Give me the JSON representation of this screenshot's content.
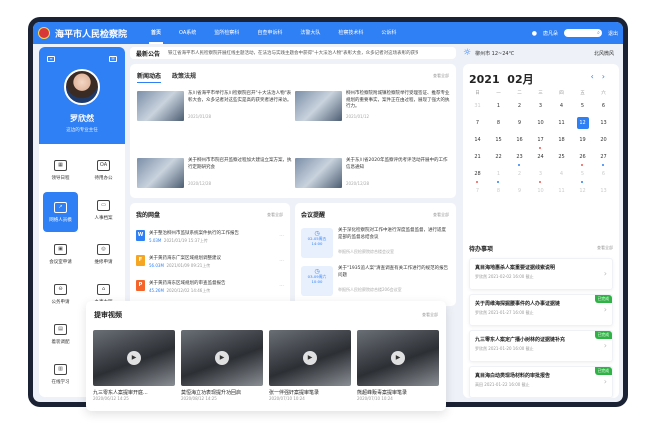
{
  "app": {
    "title": "海平市人民检察院",
    "nav": [
      "首页",
      "OA系统",
      "监所检察科",
      "自查申诉科",
      "法警大队",
      "检察技术科",
      "公诉科"
    ],
    "user_label": "唐凡朵",
    "search_placeholder": "",
    "logout": "退出"
  },
  "profile": {
    "name": "罗欣然",
    "title": "这边的专业主任"
  },
  "menu": [
    {
      "label": "领导日程",
      "icon": "calendar-icon"
    },
    {
      "label": "待用办公",
      "icon": "oa-icon"
    },
    {
      "label": "网络人员模",
      "icon": "chart-icon",
      "active": true
    },
    {
      "label": "人事档案",
      "icon": "folder-icon"
    },
    {
      "label": "会议室申请",
      "icon": "meeting-icon"
    },
    {
      "label": "维修申请",
      "icon": "wrench-icon"
    },
    {
      "label": "公务申请",
      "icon": "car-icon"
    },
    {
      "label": "办事大厅",
      "icon": "hall-icon"
    },
    {
      "label": "着装调配",
      "icon": "clothes-icon"
    },
    {
      "label": "",
      "icon": "blank"
    },
    {
      "label": "在线学习",
      "icon": "study-icon"
    }
  ],
  "announcement": {
    "title": "最新公告",
    "text": "铁江省海平市人民检察院开展红线主题活动，在法治与实践主题会中获得\"十大法治人物\"表彰大会，众多记者对这场表彰的获奖者进行了采访。"
  },
  "weather": {
    "text": "柳州市 12~24℃",
    "location": "北风微风"
  },
  "news": {
    "tabs": [
      "新闻动态",
      "政策法规"
    ],
    "more": "查看全部",
    "items": [
      {
        "title": "东川省海平市举行东川检察院召开\"十大法治人物\"表彰大会，众多记者对这些实是高的获奖者进行采访。",
        "date": "2021/01/28"
      },
      {
        "title": "柳州市检察院附城镇检察院举行受理签证、推荐专业规划的重要事实，案件正在由过程，展现了强大的执行力。",
        "date": "2021/01/12"
      },
      {
        "title": "关于柳州市市院召开监察过程加大建设立案方案，执行定期研究会",
        "date": "2020/12/28"
      },
      {
        "title": "关于东川省2020年监察评优考评活动开展中的工作信息通知",
        "date": "2020/12/28"
      }
    ]
  },
  "disk": {
    "title": "我的网盘",
    "more": "查看全部",
    "files": [
      {
        "name": "关于整治柳州市监狱系统案件执行的工作报告",
        "size": "5.03M",
        "date": "2021/01/19 15:37上传",
        "type": "W",
        "color": "#2f7ff5"
      },
      {
        "name": "关于黄药海东广案区域规划调整建议",
        "size": "56.03M",
        "date": "2021/01/09 09:21上传",
        "type": "F",
        "color": "#f5a623"
      },
      {
        "name": "关于黄药海东区域规划的审查监督报告",
        "size": "45.26M",
        "date": "2020/12/02 14:46上传",
        "type": "P",
        "color": "#f5642a"
      }
    ]
  },
  "meeting": {
    "title": "会议提醒",
    "more": "查看全部",
    "items": [
      {
        "date": "02-05周五",
        "time": "14:00",
        "title": "关于深化检察院对工作中进行深度监督监督，进行适度是部的监督总结会议",
        "loc": "举报所人民检察院综合楼会议室"
      },
      {
        "date": "03-09周六",
        "time": "10:00",
        "title": "关于\"1935追人案\"清查调查有关工作进行的规范的报告问题",
        "loc": "举报所人民检察院综合楼206会议室"
      }
    ]
  },
  "video": {
    "title": "提审视频",
    "more": "查看全部",
    "items": [
      {
        "title": "九三零东人案提审开庭...",
        "date": "2020/06/12  14:25"
      },
      {
        "title": "莫恒海立功表现提升功回启",
        "date": "2020/08/12  14:25"
      },
      {
        "title": "张一伴强奸案提审笔录",
        "date": "2020/07/10  10:24"
      },
      {
        "title": "熊超峰贩毒案提审笔录",
        "date": "2020/07/10  10:24"
      }
    ]
  },
  "calendar": {
    "year": "2021",
    "month": "02月",
    "weekdays": [
      "日",
      "一",
      "二",
      "三",
      "四",
      "五",
      "六"
    ],
    "days": [
      {
        "d": "31",
        "m": true
      },
      {
        "d": "1"
      },
      {
        "d": "2"
      },
      {
        "d": "3"
      },
      {
        "d": "4"
      },
      {
        "d": "5"
      },
      {
        "d": "6"
      },
      {
        "d": "7"
      },
      {
        "d": "8"
      },
      {
        "d": "9"
      },
      {
        "d": "10"
      },
      {
        "d": "11"
      },
      {
        "d": "12",
        "today": true
      },
      {
        "d": "13"
      },
      {
        "d": "14"
      },
      {
        "d": "15"
      },
      {
        "d": "16"
      },
      {
        "d": "17",
        "dot": "#e55"
      },
      {
        "d": "18"
      },
      {
        "d": "19"
      },
      {
        "d": "20"
      },
      {
        "d": "21"
      },
      {
        "d": "22"
      },
      {
        "d": "23",
        "dot": "#2f7ff5"
      },
      {
        "d": "24"
      },
      {
        "d": "25"
      },
      {
        "d": "26",
        "dot": "#e55"
      },
      {
        "d": "27",
        "dot": "#2f7ff5"
      },
      {
        "d": "28",
        "dot": "#e55"
      },
      {
        "d": "1",
        "m": true,
        "dot": "#2f7ff5"
      },
      {
        "d": "2",
        "m": true
      },
      {
        "d": "3",
        "m": true,
        "dot": "#e55"
      },
      {
        "d": "4",
        "m": true
      },
      {
        "d": "5",
        "m": true,
        "dot": "#2f7ff5"
      },
      {
        "d": "6",
        "m": true
      },
      {
        "d": "7",
        "m": true
      },
      {
        "d": "8",
        "m": true
      },
      {
        "d": "9",
        "m": true
      },
      {
        "d": "10",
        "m": true
      },
      {
        "d": "11",
        "m": true
      },
      {
        "d": "12",
        "m": true
      },
      {
        "d": "13",
        "m": true
      }
    ]
  },
  "todo": {
    "title": "待办事项",
    "more": "查看全部",
    "items": [
      {
        "title": "真目海地惠杀人案重要证据线索说明",
        "sub": "罗欣然   2021-02-02 16:00 截止",
        "badge": ""
      },
      {
        "title": "关于周维海探掘腰事件的人办事证据链",
        "sub": "罗欣然   2021-01-27 16:00 截止",
        "badge": "已完成"
      },
      {
        "title": "九三零东人案定广播小树林的证据链补充",
        "sub": "罗欣然   2021-01-20 16:00 截止",
        "badge": "已完成"
      },
      {
        "title": "真目海白动类现场材料的审批报告",
        "sub": "高田   2021-01-22 16:00 截止",
        "badge": "已完成"
      }
    ]
  }
}
